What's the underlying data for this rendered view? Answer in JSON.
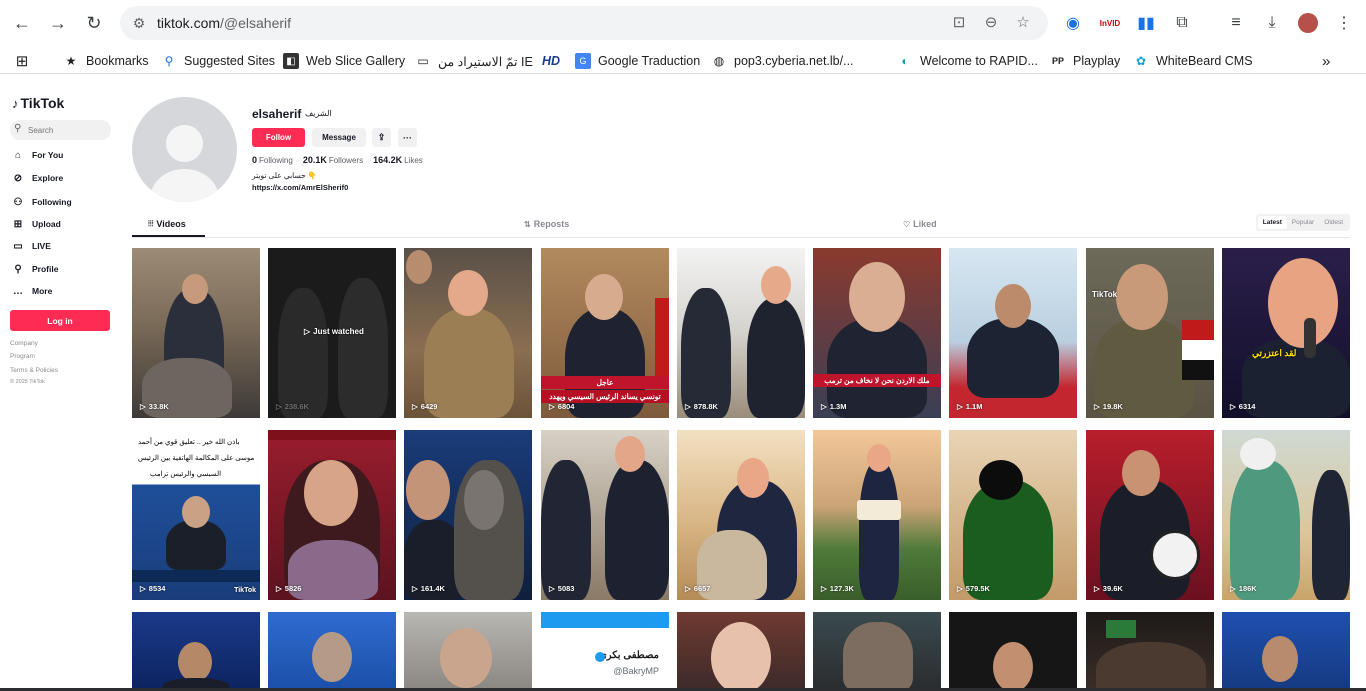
{
  "browser": {
    "url_host": "tiktok.com",
    "url_path": "/@elsaherif",
    "bookmarks": [
      {
        "label": "Bookmarks",
        "icon": "star-icon"
      },
      {
        "label": "Suggested Sites",
        "icon": "search-icon"
      },
      {
        "label": "Web Slice Gallery",
        "icon": "web-slice-icon"
      },
      {
        "label": "تمّ الاستيراد من IE",
        "icon": "folder-icon"
      },
      {
        "label": "HD",
        "icon": "hd-icon"
      },
      {
        "label": "Google Traduction",
        "icon": "translate-icon"
      },
      {
        "label": "pop3.cyberia.net.lb/...",
        "icon": "globe-icon"
      },
      {
        "label": "Welcome to RAPID...",
        "icon": "rapid-icon"
      },
      {
        "label": "Playplay",
        "icon": "playplay-icon"
      },
      {
        "label": "WhiteBeard CMS",
        "icon": "whitebeard-icon"
      }
    ]
  },
  "sidebar": {
    "logo": "TikTok",
    "search_placeholder": "Search",
    "items": [
      {
        "label": "For You",
        "icon": "home-icon"
      },
      {
        "label": "Explore",
        "icon": "compass-icon"
      },
      {
        "label": "Following",
        "icon": "following-icon"
      },
      {
        "label": "Upload",
        "icon": "upload-icon"
      },
      {
        "label": "LIVE",
        "icon": "live-icon"
      },
      {
        "label": "Profile",
        "icon": "profile-icon"
      },
      {
        "label": "More",
        "icon": "more-icon"
      }
    ],
    "login": "Log in",
    "footer": [
      "Company",
      "Program",
      "Terms & Policies",
      "© 2025 TikTok"
    ]
  },
  "profile": {
    "username": "elsaherif",
    "nickname": "الشريف",
    "follow": "Follow",
    "message": "Message",
    "stats": {
      "following_count": "0",
      "following_label": "Following",
      "followers_count": "20.1K",
      "followers_label": "Followers",
      "likes_count": "164.2K",
      "likes_label": "Likes"
    },
    "bio": "حسابي على تويتر 👇",
    "link": "https://x.com/AmrElSherif0"
  },
  "tabs": {
    "videos": "Videos",
    "reposts": "Reposts",
    "liked": "Liked",
    "sort": [
      "Latest",
      "Popular",
      "Oldest"
    ]
  },
  "videos": [
    {
      "views": "33.8K"
    },
    {
      "views": "238.6K",
      "overlay": "Just watched"
    },
    {
      "views": "6429"
    },
    {
      "views": "6804",
      "caption_top": "عاجل",
      "caption_bottom": "تونسي يساند الرئيس السيسي ويهدد"
    },
    {
      "views": "878.8K"
    },
    {
      "views": "1.3M",
      "caption": "ملك الاردن نحن لا نخاف من ترمب"
    },
    {
      "views": "1.1M"
    },
    {
      "views": "19.8K",
      "overlay": "TikTok"
    },
    {
      "views": "6314",
      "overlay": "لقد اعتزرتي"
    },
    {
      "views": "8534",
      "caption_lines": [
        "باذن الله خير .. تعليق قوي من أحمد",
        "موسى على المكالمة الهاتفية بين الرئيس",
        "السيسي والرئيس ترامب"
      ],
      "corner": "TikTok"
    },
    {
      "views": "5826"
    },
    {
      "views": "161.4K"
    },
    {
      "views": "5083"
    },
    {
      "views": "6657"
    },
    {
      "views": "127.3K"
    },
    {
      "views": "579.5K"
    },
    {
      "views": "39.6K"
    },
    {
      "views": "186K"
    },
    {
      "views": ""
    },
    {
      "views": ""
    },
    {
      "views": ""
    },
    {
      "views": "",
      "name_ar": "مصطفى بكري",
      "handle": "@BakryMP"
    },
    {
      "views": ""
    },
    {
      "views": ""
    },
    {
      "views": ""
    },
    {
      "views": ""
    },
    {
      "views": ""
    }
  ],
  "colors": {
    "brand": "#fe2c55",
    "text": "#161823",
    "muted": "#8a8b91"
  }
}
